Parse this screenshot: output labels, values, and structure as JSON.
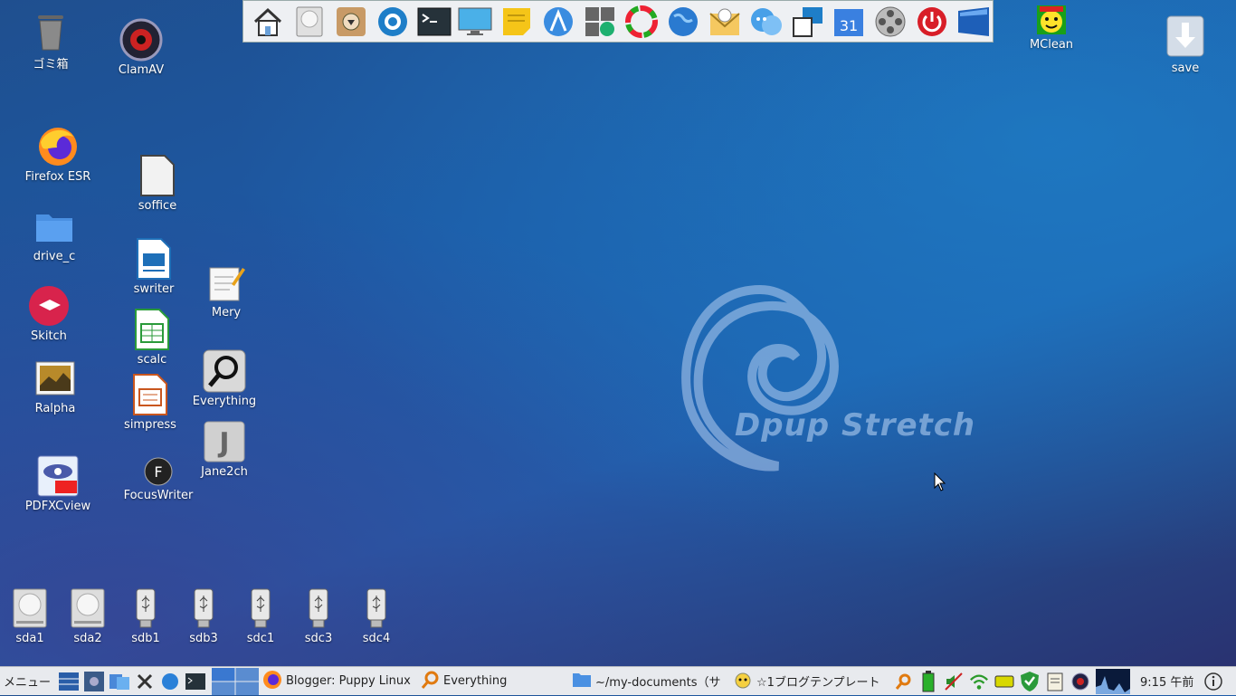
{
  "desktop": {
    "logo_text": "Dpup Stretch",
    "icons": {
      "trash": "ゴミ箱",
      "clamav": "ClamAV",
      "firefox": "Firefox ESR",
      "soffice": "soffice",
      "drive_c": "drive_c",
      "swriter": "swriter",
      "mery": "Mery",
      "skitch": "Skitch",
      "scalc": "scalc",
      "ralpha": "Ralpha",
      "everything": "Everything",
      "simpress": "simpress",
      "jane2ch": "Jane2ch",
      "pdfxcview": "PDFXCview",
      "focuswriter": "FocusWriter",
      "mclean": "MClean",
      "save": "save"
    },
    "drives": [
      "sda1",
      "sda2",
      "sdb1",
      "sdb3",
      "sdc1",
      "sdc3",
      "sdc4"
    ],
    "focuswriter_glyph": "F",
    "jane_glyph": "J",
    "calendar_day": "31"
  },
  "taskbar": {
    "menu_label": "メニュー",
    "tasks": [
      "Blogger: Puppy Linux",
      "Everything",
      "~/my-documents（サ",
      "☆1ブログテンプレート"
    ],
    "clock": "9:15 午前"
  },
  "colors": {
    "accent": "#1e62b0",
    "taskbar_bg": "#e8eaee"
  }
}
